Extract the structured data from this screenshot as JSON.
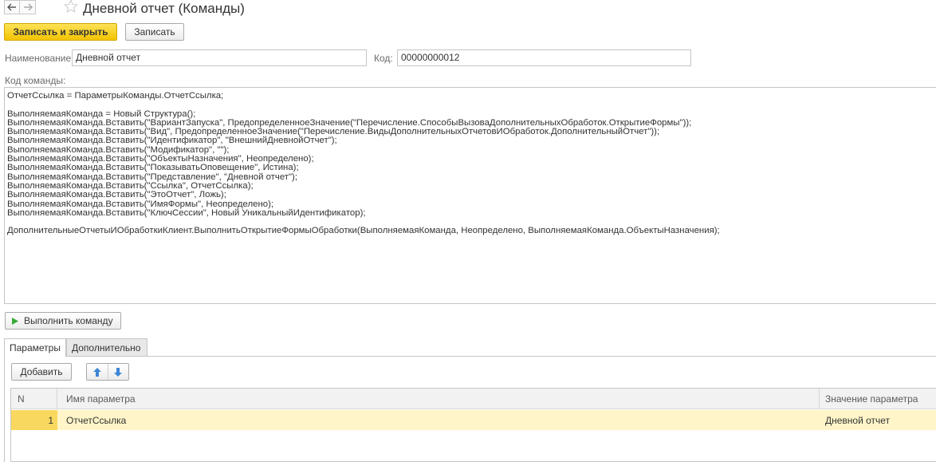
{
  "window": {
    "title": "Дневной отчет (Команды)"
  },
  "icons": {
    "back": "arrow-left-icon",
    "forward": "arrow-right-icon",
    "favorite": "star-icon",
    "run": "play-icon",
    "up": "arrow-up-icon",
    "down": "arrow-down-icon"
  },
  "colors": {
    "primary": "#f4c500",
    "row_highlight": "#fff5c8",
    "arrow_blue": "#3d86d6",
    "run_green": "#3aa836"
  },
  "toolbar": {
    "save_close_label": "Записать и закрыть",
    "save_label": "Записать"
  },
  "form": {
    "name_label": "Наименование:",
    "name_value": "Дневной отчет",
    "code_label": "Код:",
    "code_value": "00000000012",
    "command_code_label": "Код команды:"
  },
  "code_lines": [
    "ОтчетСсылка = ПараметрыКоманды.ОтчетСсылка;",
    "",
    "ВыполняемаяКоманда = Новый Структура();",
    "ВыполняемаяКоманда.Вставить(\"ВариантЗапуска\", ПредопределенноеЗначение(\"Перечисление.СпособыВызоваДополнительныхОбработок.ОткрытиеФормы\"));",
    "ВыполняемаяКоманда.Вставить(\"Вид\", ПредопределенноеЗначение(\"Перечисление.ВидыДополнительныхОтчетовИОбработок.ДополнительныйОтчет\"));",
    "ВыполняемаяКоманда.Вставить(\"Идентификатор\", \"ВнешнийДневнойОтчет\");",
    "ВыполняемаяКоманда.Вставить(\"Модификатор\", \"\");",
    "ВыполняемаяКоманда.Вставить(\"ОбъектыНазначения\", Неопределено);",
    "ВыполняемаяКоманда.Вставить(\"ПоказыватьОповещение\", Истина);",
    "ВыполняемаяКоманда.Вставить(\"Представление\", \"Дневной отчет\");",
    "ВыполняемаяКоманда.Вставить(\"Ссылка\", ОтчетСсылка);",
    "ВыполняемаяКоманда.Вставить(\"ЭтоОтчет\", Ложь);",
    "ВыполняемаяКоманда.Вставить(\"ИмяФормы\", Неопределено);",
    "ВыполняемаяКоманда.Вставить(\"КлючСессии\", Новый УникальныйИдентификатор);",
    "",
    "ДополнительныеОтчетыИОбработкиКлиент.ВыполнитьОткрытиеФормыОбработки(ВыполняемаяКоманда, Неопределено, ВыполняемаяКоманда.ОбъектыНазначения);"
  ],
  "run_button_label": "Выполнить команду",
  "tabs": [
    {
      "label": "Параметры"
    },
    {
      "label": "Дополнительно"
    }
  ],
  "params_toolbar": {
    "add_label": "Добавить"
  },
  "table": {
    "columns": [
      "N",
      "Имя параметра",
      "Значение параметра"
    ],
    "rows": [
      {
        "n": "1",
        "name": "ОтчетСсылка",
        "value": "Дневной отчет"
      }
    ]
  }
}
